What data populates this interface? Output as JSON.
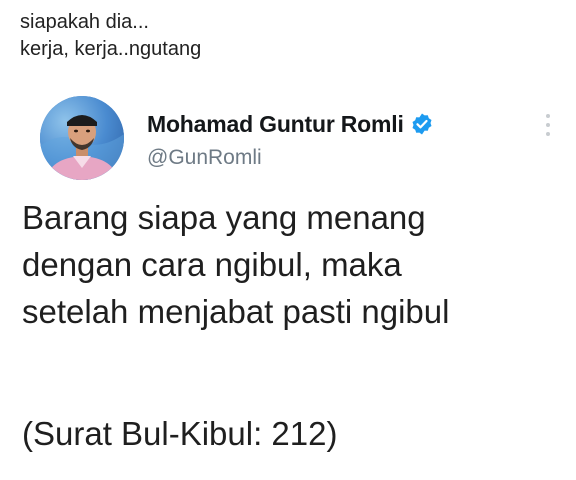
{
  "caption": {
    "line1": "siapakah dia...",
    "line2": "kerja, kerja..ngutang"
  },
  "tweet": {
    "author": {
      "display_name": "Mohamad Guntur Romli",
      "handle": "@GunRomli",
      "verified": true,
      "avatar_icon": "avatar-photo",
      "verified_icon": "verified-badge-icon"
    },
    "more_icon": "more-vertical-icon",
    "body_lines": [
      "Barang siapa yang menang",
      "dengan cara ngibul, maka",
      "setelah menjabat pasti ngibul"
    ],
    "citation": "(Surat Bul-Kibul: 212)"
  },
  "colors": {
    "verified_badge": "#1d9bf0",
    "handle_text": "#6e7a85",
    "name_text": "#14171a"
  }
}
